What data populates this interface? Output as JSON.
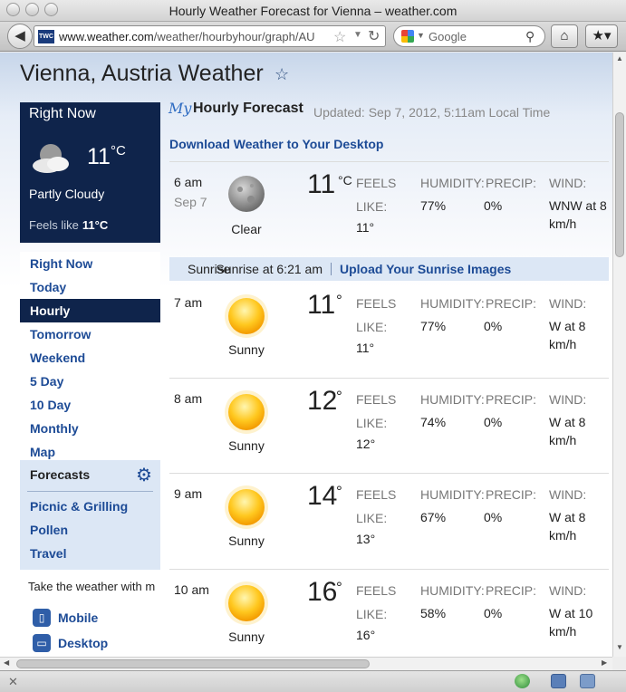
{
  "window": {
    "title": "Hourly Weather Forecast for Vienna – weather.com"
  },
  "toolbar": {
    "site_badge": "TWC",
    "url_domain": "www.weather.com",
    "url_path": "/weather/hourbyhour/graph/AU",
    "search_placeholder": "Google"
  },
  "page": {
    "title": "Vienna, Austria Weather",
    "right_now": {
      "title": "Right Now",
      "temp": "11",
      "unit": "°C",
      "condition": "Partly Cloudy",
      "feels_label": "Feels like",
      "feels_value": "11°C"
    },
    "nav": [
      "Right Now",
      "Today",
      "Hourly",
      "Tomorrow",
      "Weekend",
      "5 Day",
      "10 Day",
      "Monthly",
      "Map"
    ],
    "nav_active": "Hourly",
    "forecasts": {
      "heading": "Forecasts",
      "links": [
        "Picnic & Grilling",
        "Pollen",
        "Travel"
      ]
    },
    "take_weather_text": "Take the weather with m",
    "apps": [
      "Mobile",
      "Desktop"
    ],
    "hourly": {
      "my_label": "My",
      "title": "Hourly Forecast",
      "updated": "Updated: Sep 7, 2012, 5:11am Local Time",
      "download_link": "Download Weather to Your Desktop",
      "feels_label_1": "FEELS",
      "feels_label_2": "LIKE:",
      "humidity_label": "HUMIDITY:",
      "precip_label": "PRECIP:",
      "wind_label": "WIND:",
      "sunrise_label": "Sunrise",
      "sunrise_text": "Sunrise at 6:21 am",
      "upload_link": "Upload Your Sunrise Images",
      "rows": [
        {
          "time": "6 am",
          "date": "Sep 7",
          "icon": "moon-icon",
          "condition": "Clear",
          "temp": "11",
          "unit": "°C",
          "feels": "11°",
          "humidity": "77%",
          "precip": "0%",
          "wind_1": "WNW at 8",
          "wind_2": "km/h"
        },
        {
          "time": "7 am",
          "date": "",
          "icon": "sun-icon",
          "condition": "Sunny",
          "temp": "11",
          "unit": "°",
          "feels": "11°",
          "humidity": "77%",
          "precip": "0%",
          "wind_1": "W at 8",
          "wind_2": "km/h"
        },
        {
          "time": "8 am",
          "date": "",
          "icon": "sun-icon",
          "condition": "Sunny",
          "temp": "12",
          "unit": "°",
          "feels": "12°",
          "humidity": "74%",
          "precip": "0%",
          "wind_1": "W at 8",
          "wind_2": "km/h"
        },
        {
          "time": "9 am",
          "date": "",
          "icon": "sun-icon",
          "condition": "Sunny",
          "temp": "14",
          "unit": "°",
          "feels": "13°",
          "humidity": "67%",
          "precip": "0%",
          "wind_1": "W at 8",
          "wind_2": "km/h"
        },
        {
          "time": "10 am",
          "date": "",
          "icon": "sun-icon",
          "condition": "Sunny",
          "temp": "16",
          "unit": "°",
          "feels": "16°",
          "humidity": "58%",
          "precip": "0%",
          "wind_1": "W at 10",
          "wind_2": "km/h"
        }
      ]
    }
  }
}
